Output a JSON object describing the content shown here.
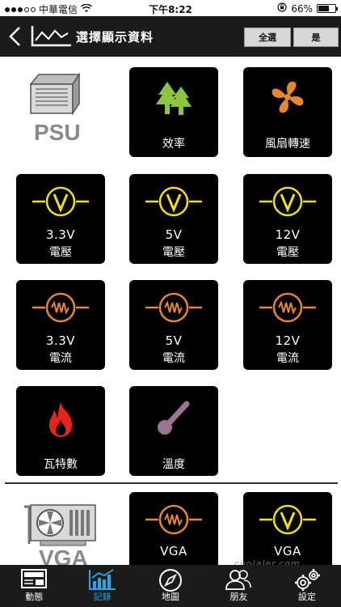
{
  "status_bar": {
    "carrier": "中華電信",
    "time": "下午8:22",
    "battery": "66%",
    "battery_level": 0.66
  },
  "navbar": {
    "title": "選擇顯示資料",
    "select_all_label": "全選",
    "confirm_label": "是"
  },
  "devices": {
    "psu_label": "PSU",
    "vga_label": "VGA"
  },
  "tiles": {
    "efficiency": {
      "label": "效率"
    },
    "fan_speed": {
      "label": "風扇轉速"
    },
    "v33": {
      "value": "3.3V",
      "label": "電壓"
    },
    "v5": {
      "value": "5V",
      "label": "電壓"
    },
    "v12": {
      "value": "12V",
      "label": "電壓"
    },
    "a33": {
      "value": "3.3V",
      "label": "電流"
    },
    "a5": {
      "value": "5V",
      "label": "電流"
    },
    "a12": {
      "value": "12V",
      "label": "電流"
    },
    "watts": {
      "label": "瓦特數"
    },
    "temp": {
      "label": "溫度"
    },
    "vga_current": {
      "value": "VGA"
    },
    "vga_voltage": {
      "value": "VGA"
    }
  },
  "watermark": "coolaler.com",
  "tabbar": {
    "items": [
      {
        "label": "動態",
        "icon": "news-icon"
      },
      {
        "label": "記錄",
        "icon": "chart-icon",
        "active": true
      },
      {
        "label": "地圖",
        "icon": "compass-icon"
      },
      {
        "label": "朋友",
        "icon": "friends-icon"
      },
      {
        "label": "設定",
        "icon": "gear-icon"
      }
    ]
  },
  "colors": {
    "voltage": "#f2e400",
    "current": "#e8862c",
    "efficiency": "#8cc63f",
    "fan": "#e8862c",
    "watts": "#e6241a",
    "temperature": "#9c7392",
    "active_tab": "#2aa6e6"
  }
}
